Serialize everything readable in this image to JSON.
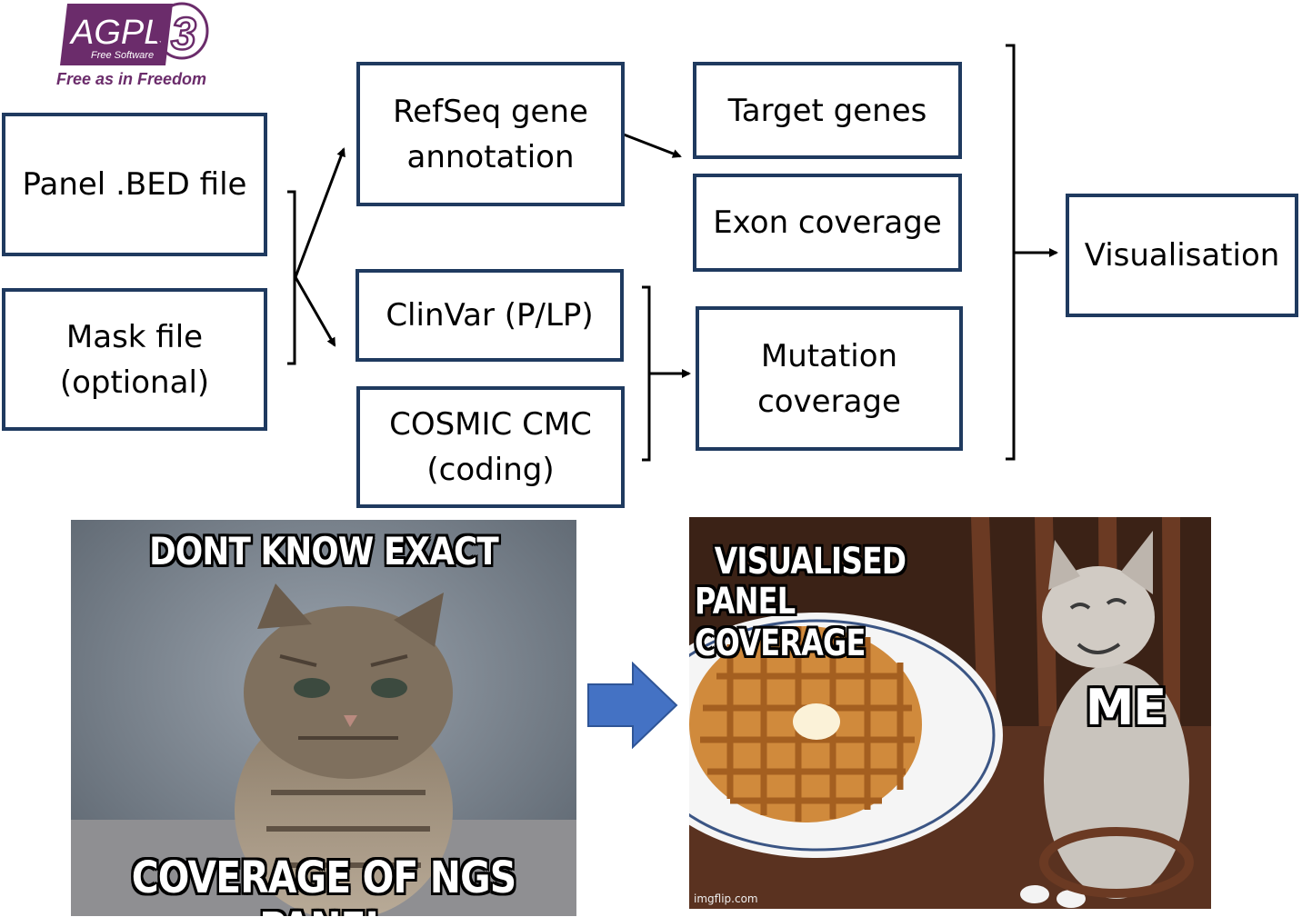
{
  "logo": {
    "main": "AGPL",
    "version": "3",
    "subtitle": "Free Software",
    "tagline": "Free as in Freedom"
  },
  "inputs": {
    "panel": "Panel .BED file",
    "mask_line1": "Mask file",
    "mask_line2": "(optional)"
  },
  "sources": {
    "refseq_line1": "RefSeq gene",
    "refseq_line2": "annotation",
    "clinvar": "ClinVar (P/LP)",
    "cosmic_line1": "COSMIC CMC",
    "cosmic_line2": "(coding)"
  },
  "outputs": {
    "target_genes": "Target genes",
    "exon_coverage": "Exon coverage",
    "mutation_line1": "Mutation",
    "mutation_line2": "coverage"
  },
  "final": {
    "visualisation": "Visualisation"
  },
  "meme_left": {
    "top_text": "DONT KNOW EXACT",
    "bottom_text": "COVERAGE OF NGS PANEL"
  },
  "meme_right": {
    "top_line1": "VISUALISED",
    "top_line2": "PANEL COVERAGE",
    "label": "ME",
    "watermark": "imgflip.com"
  },
  "colors": {
    "box_border": "#1f3a5f",
    "arrow": "#000000",
    "block_arrow": "#4472c4",
    "logo": "#6b2c6b"
  }
}
